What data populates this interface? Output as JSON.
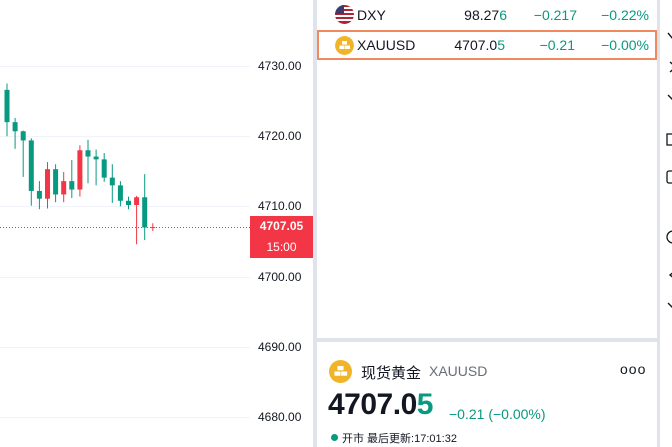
{
  "chart": {
    "y_axis_labels": [
      "4730.00",
      "4720.00",
      "4710.00",
      "4700.00",
      "4690.00",
      "4680.00"
    ],
    "current_price_tag": "4707.05",
    "countdown_tag": "15:00",
    "candles": [
      {
        "o": 4726.6,
        "h": 4727.5,
        "l": 4720.0,
        "c": 4722.0
      },
      {
        "o": 4722.0,
        "h": 4722.6,
        "l": 4718.2,
        "c": 4720.7
      },
      {
        "o": 4720.7,
        "h": 4720.8,
        "l": 4714.2,
        "c": 4719.4
      },
      {
        "o": 4719.4,
        "h": 4719.7,
        "l": 4710.1,
        "c": 4712.2
      },
      {
        "o": 4712.2,
        "h": 4713.6,
        "l": 4709.6,
        "c": 4711.1
      },
      {
        "o": 4711.1,
        "h": 4716.3,
        "l": 4709.7,
        "c": 4715.3
      },
      {
        "o": 4715.3,
        "h": 4716.0,
        "l": 4710.6,
        "c": 4711.7
      },
      {
        "o": 4711.7,
        "h": 4714.9,
        "l": 4710.6,
        "c": 4713.6
      },
      {
        "o": 4713.6,
        "h": 4716.6,
        "l": 4711.2,
        "c": 4712.4
      },
      {
        "o": 4712.4,
        "h": 4718.7,
        "l": 4711.4,
        "c": 4718.0
      },
      {
        "o": 4718.0,
        "h": 4719.5,
        "l": 4713.3,
        "c": 4717.1
      },
      {
        "o": 4717.1,
        "h": 4718.1,
        "l": 4713.0,
        "c": 4716.7
      },
      {
        "o": 4716.7,
        "h": 4717.6,
        "l": 4713.5,
        "c": 4714.1
      },
      {
        "o": 4714.1,
        "h": 4716.0,
        "l": 4710.5,
        "c": 4713.0
      },
      {
        "o": 4713.0,
        "h": 4713.6,
        "l": 4710.0,
        "c": 4710.8
      },
      {
        "o": 4710.8,
        "h": 4711.4,
        "l": 4709.6,
        "c": 4710.2
      },
      {
        "o": 4710.2,
        "h": 4711.5,
        "l": 4704.6,
        "c": 4711.3
      },
      {
        "o": 4711.3,
        "h": 4714.6,
        "l": 4705.2,
        "c": 4707.0
      },
      {
        "o": 4707.0,
        "h": 4707.6,
        "l": 4706.5,
        "c": 4707.05
      }
    ],
    "colors": {
      "up": "#f23645",
      "down": "#089981",
      "grid": "#f0f3fa",
      "price_line": "#f23645"
    }
  },
  "watchlist": {
    "rows": [
      {
        "symbol": "DXY",
        "last_main": "98.27",
        "last_tail": "6",
        "change": "−0.217",
        "change_pct": "−0.22%",
        "icon": "us-flag-icon"
      },
      {
        "symbol": "XAUUSD",
        "last_main": "4707.0",
        "last_tail": "5",
        "change": "−0.21",
        "change_pct": "−0.00%",
        "icon": "gold-bars-icon",
        "selected": true
      }
    ]
  },
  "details": {
    "name": "现货黄金",
    "symbol": "XAUUSD",
    "more_label": "ooo",
    "price_main": "4707.0",
    "price_tail": "5",
    "change": "−0.21 (−0.00%)",
    "status": "开市 最后更新:17:01:32"
  }
}
